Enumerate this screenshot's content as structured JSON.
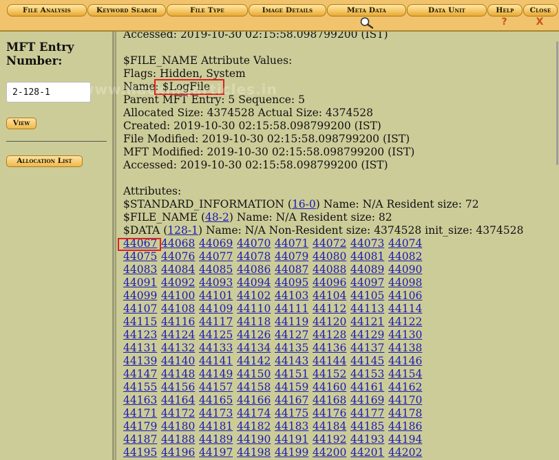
{
  "menu": {
    "items": [
      {
        "label": "File Analysis"
      },
      {
        "label": "Keyword Search"
      },
      {
        "label": "File Type"
      },
      {
        "label": "Image Details"
      },
      {
        "label": "Meta Data"
      },
      {
        "label": "Data Unit"
      },
      {
        "label": "Help"
      },
      {
        "label": "Close"
      }
    ],
    "help_sub": "?",
    "close_sub": "X",
    "search_icon": "magnifier-icon"
  },
  "left": {
    "mft_label": "MFT Entry Number:",
    "mft_value": "2-128-1",
    "view_button": "View",
    "allocation_button": "Allocation List"
  },
  "content": {
    "accessed_top": "Accessed: 2019-10-30 02:15:58.098799200 (IST)",
    "filename_header": "$FILE_NAME Attribute Values:",
    "flags": "Flags: Hidden, System",
    "name": "Name: $LogFile",
    "parent": "Parent MFT Entry: 5 Sequence: 5",
    "allocated": "Allocated Size: 4374528 Actual Size: 4374528",
    "created": "Created: 2019-10-30 02:15:58.098799200 (IST)",
    "file_modified": "File Modified: 2019-10-30 02:15:58.098799200 (IST)",
    "mft_modified": "MFT Modified: 2019-10-30 02:15:58.098799200 (IST)",
    "accessed": "Accessed: 2019-10-30 02:15:58.098799200 (IST)",
    "attributes_header": "Attributes:",
    "attr1": {
      "prefix": "$STANDARD_INFORMATION (",
      "link": "16-0",
      "suffix": ") Name: N/A Resident size: 72"
    },
    "attr2": {
      "prefix": "$FILE_NAME (",
      "link": "48-2",
      "suffix": ") Name: N/A Resident size: 82"
    },
    "attr3": {
      "prefix": "$DATA (",
      "link": "128-1",
      "suffix": ") Name: N/A Non-Resident size: 4374528 init_size: 4374528"
    }
  },
  "blocks": {
    "start": 44067,
    "end": 44202
  },
  "watermark": "www.hackingarticles.in",
  "colors": {
    "background": "#cccc99",
    "menubar": "#f1c36c",
    "link": "#1a1ab0",
    "highlight": "#e02020"
  }
}
